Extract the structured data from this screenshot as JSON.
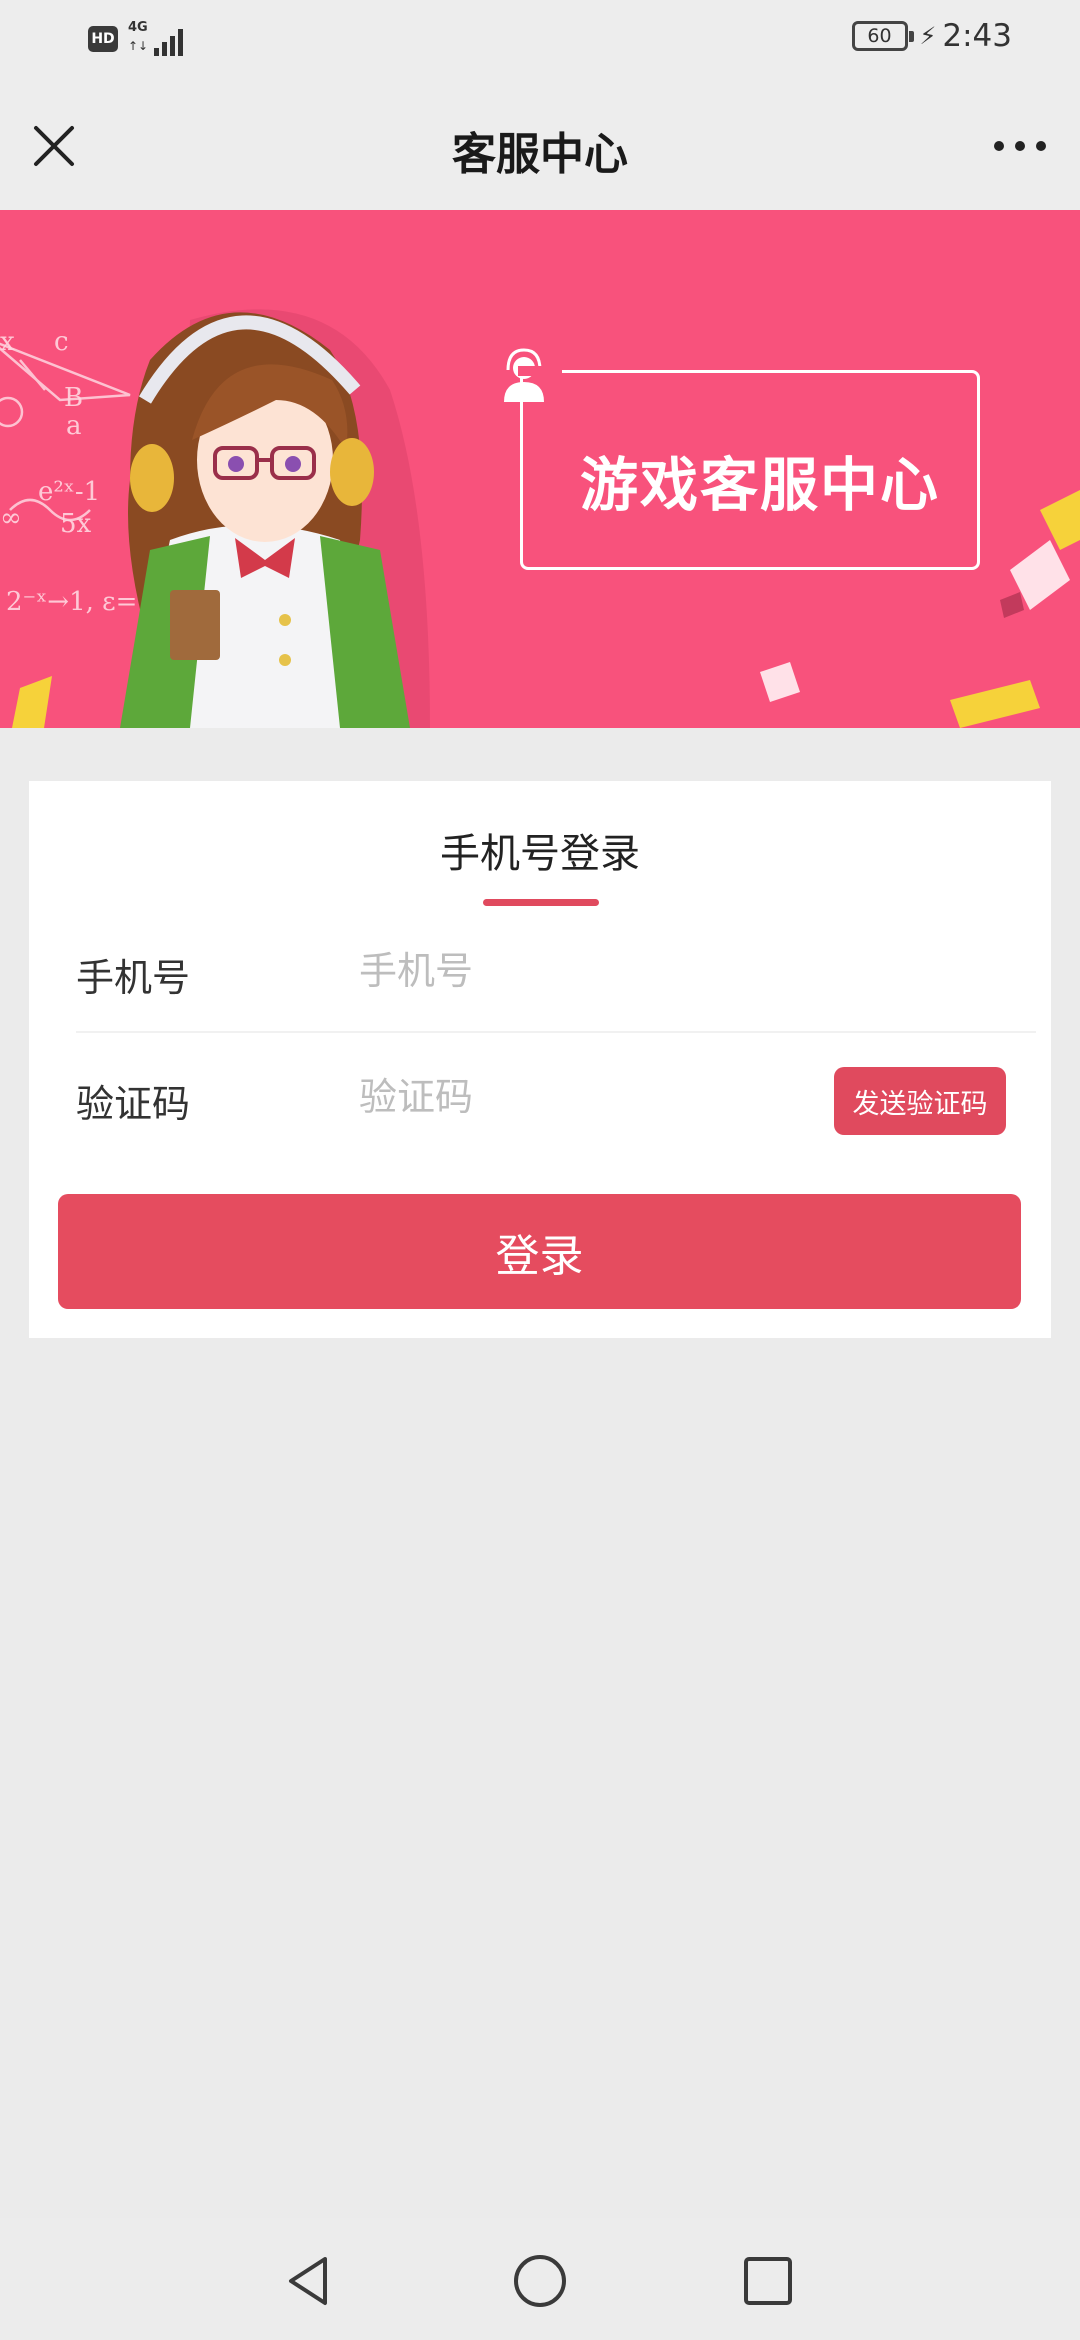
{
  "status_bar": {
    "hd_label": "HD",
    "network_label": "4G",
    "network_arrows": "↑↓",
    "battery_level": "60",
    "charging_icon": "bolt-icon",
    "time": "2:43"
  },
  "title_bar": {
    "title": "客服中心",
    "close_icon": "close-icon",
    "more_icon": "more-dots-icon"
  },
  "banner": {
    "title": "游戏客服中心",
    "headset_icon": "customer-service-icon",
    "background_color": "#f8527c"
  },
  "login": {
    "tab_title": "手机号登录",
    "phone_label": "手机号",
    "phone_placeholder": "手机号",
    "phone_value": "",
    "code_label": "验证码",
    "code_placeholder": "验证码",
    "code_value": "",
    "send_code_button": "发送验证码",
    "login_button": "登录",
    "accent_color": "#e54c5f"
  },
  "nav_bar": {
    "back_icon": "triangle-back-icon",
    "home_icon": "circle-home-icon",
    "recents_icon": "square-recents-icon"
  }
}
